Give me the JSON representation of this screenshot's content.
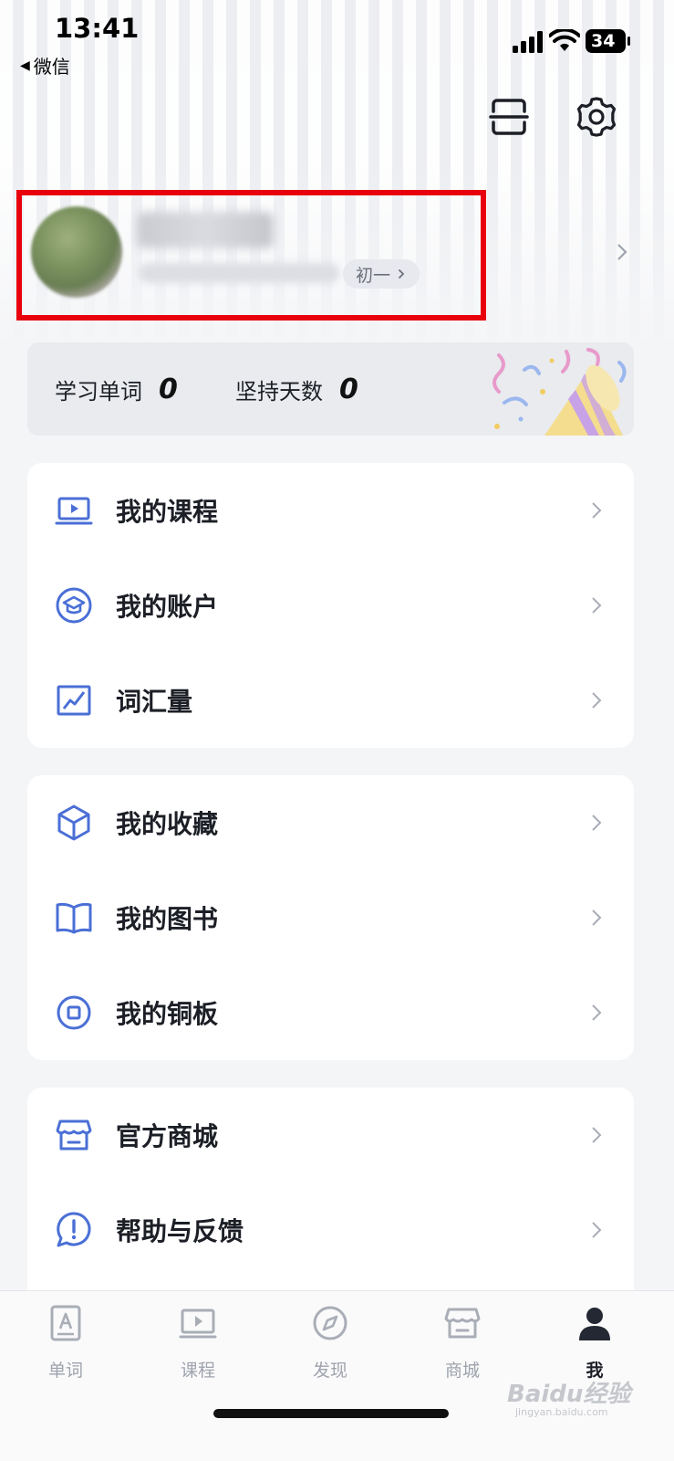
{
  "status_bar": {
    "time": "13:41",
    "back_app": "微信",
    "battery": "34"
  },
  "header": {
    "scan_icon": "scan-icon",
    "settings_icon": "gear-icon"
  },
  "profile": {
    "level_tag": "初一"
  },
  "stats": {
    "words_label": "学习单词",
    "words_value": "0",
    "days_label": "坚持天数",
    "days_value": "0"
  },
  "menu_groups": [
    [
      {
        "label": "我的课程",
        "icon": "video-course-icon"
      },
      {
        "label": "我的账户",
        "icon": "graduation-cap-icon"
      },
      {
        "label": "词汇量",
        "icon": "line-chart-icon"
      }
    ],
    [
      {
        "label": "我的收藏",
        "icon": "cube-icon"
      },
      {
        "label": "我的图书",
        "icon": "book-icon"
      },
      {
        "label": "我的铜板",
        "icon": "coin-icon"
      }
    ],
    [
      {
        "label": "官方商城",
        "icon": "store-icon"
      },
      {
        "label": "帮助与反馈",
        "icon": "help-feedback-icon"
      }
    ]
  ],
  "tabbar": [
    {
      "label": "单词",
      "icon": "word-card-icon",
      "active": false
    },
    {
      "label": "课程",
      "icon": "video-course-icon",
      "active": false
    },
    {
      "label": "发现",
      "icon": "compass-icon",
      "active": false
    },
    {
      "label": "商城",
      "icon": "store-icon",
      "active": false
    },
    {
      "label": "我",
      "icon": "person-icon",
      "active": true
    }
  ],
  "watermark": {
    "text": "Baidu经验",
    "url": "jingyan.baidu.com"
  },
  "colors": {
    "accent": "#4a6fd6",
    "highlight": "#e8000c",
    "text": "#1c1f26"
  }
}
